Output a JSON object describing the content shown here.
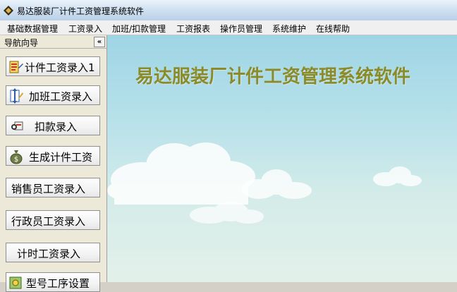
{
  "window": {
    "title": "易达服装厂计件工资管理系统软件"
  },
  "menu": [
    "基础数据管理",
    "工资录入",
    "加班/扣款管理",
    "工资报表",
    "操作员管理",
    "系统维护",
    "在线帮助"
  ],
  "nav": {
    "title": "导航向导",
    "collapse_symbol": "«",
    "buttons": [
      {
        "label": "计件工资录入1",
        "icon": "piecework-icon"
      },
      {
        "label": "加班工资录入",
        "icon": "overtime-icon"
      },
      {
        "label": "扣款录入",
        "icon": "deduction-icon"
      },
      {
        "label": "生成计件工资",
        "icon": "money-bag-icon"
      },
      {
        "label": "销售员工资录入",
        "icon": ""
      },
      {
        "label": "行政员工资录入",
        "icon": ""
      },
      {
        "label": "计时工资录入",
        "icon": ""
      },
      {
        "label": "型号工序设置",
        "icon": "settings-icon"
      }
    ]
  },
  "main": {
    "banner": "易达服装厂计件工资管理系统软件"
  },
  "colors": {
    "banner": "#8b8b2a",
    "sky_top": "#9ed5e5",
    "sky_bottom": "#e3f0ea"
  }
}
